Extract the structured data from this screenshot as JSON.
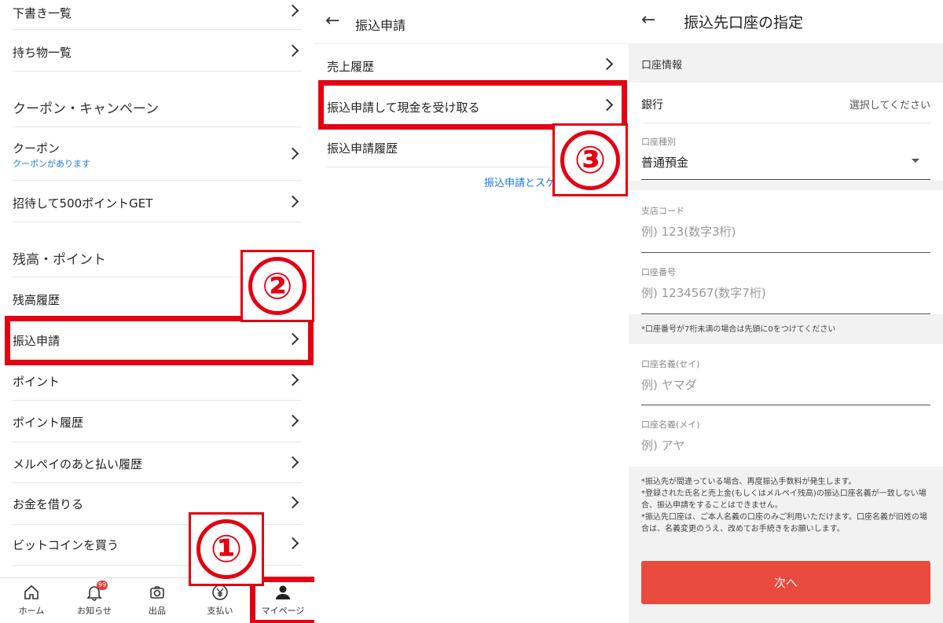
{
  "panel1": {
    "rows": [
      {
        "label": "下書き一覧"
      },
      {
        "label": "持ち物一覧"
      },
      {
        "label": "クーポン",
        "sub": "クーポンがあります"
      },
      {
        "label": "招待して500ポイントGET"
      },
      {
        "label": "残高履歴"
      },
      {
        "label": "振込申請"
      },
      {
        "label": "ポイント"
      },
      {
        "label": "ポイント履歴"
      },
      {
        "label": "メルペイのあと払い履歴"
      },
      {
        "label": "お金を借りる"
      },
      {
        "label": "ビットコインを買う"
      }
    ],
    "sections": [
      "クーポン・キャンペーン",
      "残高・ポイント"
    ],
    "nav": [
      {
        "label": "ホーム",
        "icon": "home-icon"
      },
      {
        "label": "お知らせ",
        "icon": "bell-icon",
        "badge": "99"
      },
      {
        "label": "出品",
        "icon": "camera-icon"
      },
      {
        "label": "支払い",
        "icon": "yen-icon"
      },
      {
        "label": "マイページ",
        "icon": "person-icon"
      }
    ]
  },
  "panel2": {
    "title": "振込申請",
    "rows": [
      {
        "label": "売上履歴"
      },
      {
        "label": "振込申請して現金を受け取る"
      },
      {
        "label": "振込申請履歴"
      }
    ],
    "link": "振込申請とスケ"
  },
  "panel3": {
    "title": "振込先口座の指定",
    "section": "口座情報",
    "bank_label": "銀行",
    "bank_value": "選択してください",
    "account_type_label": "口座種別",
    "account_type_value": "普通預金",
    "branch_label": "支店コード",
    "branch_placeholder": "例) 123(数字3桁)",
    "number_label": "口座番号",
    "number_placeholder": "例) 1234567(数字7桁)",
    "number_note": "*口座番号が7桁未満の場合は先頭に0をつけてください",
    "sei_label": "口座名義(セイ)",
    "sei_placeholder": "例) ヤマダ",
    "mei_label": "口座名義(メイ)",
    "mei_placeholder": "例) アヤ",
    "notes": [
      "*振込先が間違っている場合、再度振込手数料が発生します。",
      "*登録された氏名と売上金(もしくはメルペイ残高)の振込口座名義が一致しない場合、振込申請をすることはできません。",
      "*振込先口座は、ご本人名義の口座のみご利用いただけます。口座名義が旧姓の場合は、名義変更のうえ、改めてお手続きをお願いします。"
    ],
    "next_label": "次へ"
  },
  "markers": [
    "①",
    "②",
    "③"
  ],
  "colors": {
    "highlight": "#e50012",
    "link": "#1a7bd7",
    "button": "#e94a3e"
  }
}
